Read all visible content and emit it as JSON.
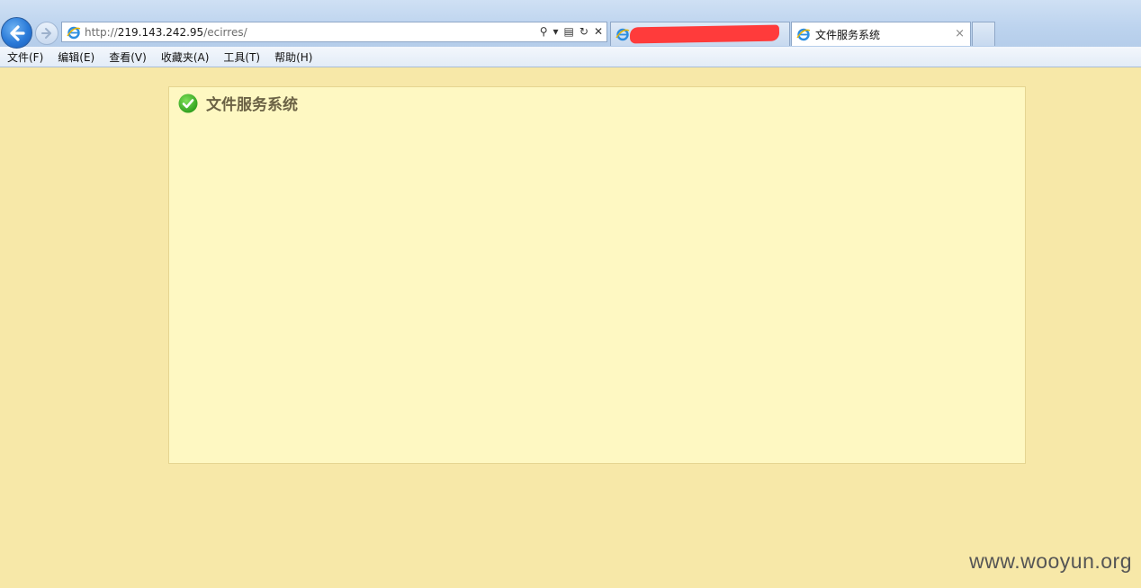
{
  "browser": {
    "address": {
      "prefix": "http://",
      "host": "219.143.242.95",
      "path": "/ecirres/"
    },
    "tabs": [
      {
        "title": "[redacted]",
        "active": false
      },
      {
        "title": "文件服务系统",
        "active": true,
        "close": "×"
      }
    ],
    "menu": [
      "文件(F)",
      "编辑(E)",
      "查看(V)",
      "收藏夹(A)",
      "工具(T)",
      "帮助(H)"
    ]
  },
  "page": {
    "title": "文件服务系统",
    "title_icon": "check-circle-icon",
    "background_color": "#f7e8a8",
    "panel_color": "#fef8c2"
  },
  "watermark": "www.wooyun.org"
}
